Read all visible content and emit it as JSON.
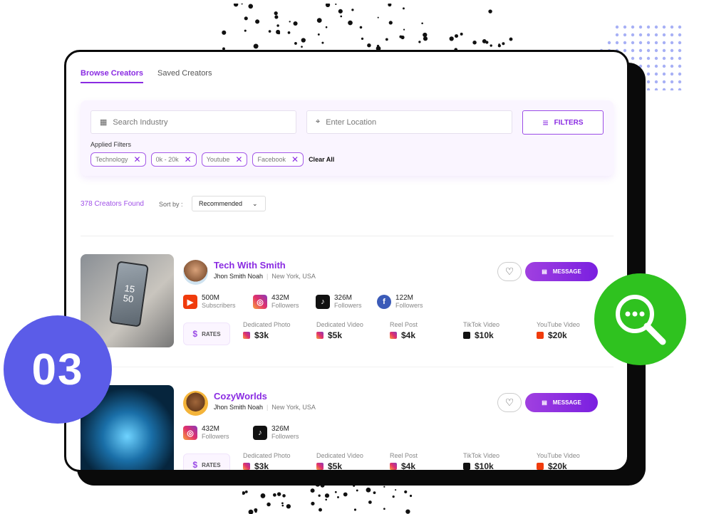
{
  "badge_number": "03",
  "tabs": [
    {
      "label": "Browse Creators",
      "active": true
    },
    {
      "label": "Saved Creators",
      "active": false
    }
  ],
  "search": {
    "industry_placeholder": "Search Industry",
    "location_placeholder": "Enter Location",
    "filters_label": "FILTERS"
  },
  "applied_filters": {
    "label": "Applied Filters",
    "chips": [
      "Technology",
      "0k - 20k",
      "Youtube",
      "Facebook"
    ],
    "clear_all": "Clear All"
  },
  "results": {
    "count_text": "378 Creators Found",
    "sort_label": "Sort by :",
    "sort_value": "Recommended"
  },
  "creators": [
    {
      "name": "Tech With Smith",
      "handle": "Jhon Smith Noah",
      "location": "New York, USA",
      "photo_text": "15\n50",
      "stats": [
        {
          "platform": "youtube",
          "value": "500M",
          "label": "Subscribers"
        },
        {
          "platform": "instagram",
          "value": "432M",
          "label": "Followers"
        },
        {
          "platform": "tiktok",
          "value": "326M",
          "label": "Followers"
        },
        {
          "platform": "facebook",
          "value": "122M",
          "label": "Followers"
        }
      ],
      "rates": [
        {
          "label": "Dedicated Photo",
          "platform": "instagram",
          "value": "$3k"
        },
        {
          "label": "Dedicated Video",
          "platform": "instagram",
          "value": "$5k"
        },
        {
          "label": "Reel Post",
          "platform": "instagram",
          "value": "$4k"
        },
        {
          "label": "TikTok Video",
          "platform": "tiktok",
          "value": "$10k"
        },
        {
          "label": "YouTube Video",
          "platform": "youtube",
          "value": "$20k"
        }
      ]
    },
    {
      "name": "CozyWorlds",
      "handle": "Jhon Smith Noah",
      "location": "New York, USA",
      "stats": [
        {
          "platform": "instagram",
          "value": "432M",
          "label": "Followers"
        },
        {
          "platform": "tiktok",
          "value": "326M",
          "label": "Followers"
        }
      ],
      "rates": [
        {
          "label": "Dedicated Photo",
          "platform": "instagram",
          "value": "$3k"
        },
        {
          "label": "Dedicated Video",
          "platform": "instagram",
          "value": "$5k"
        },
        {
          "label": "Reel Post",
          "platform": "instagram",
          "value": "$4k"
        },
        {
          "label": "TikTok Video",
          "platform": "tiktok",
          "value": "$10k"
        },
        {
          "label": "YouTube Video",
          "platform": "youtube",
          "value": "$20k"
        }
      ]
    }
  ],
  "labels": {
    "rates": "RATES",
    "message": "MESSAGE"
  },
  "colors": {
    "accent": "#8a2be2",
    "badge_blue": "#5b5ce8",
    "search_green": "#2fc21f"
  }
}
